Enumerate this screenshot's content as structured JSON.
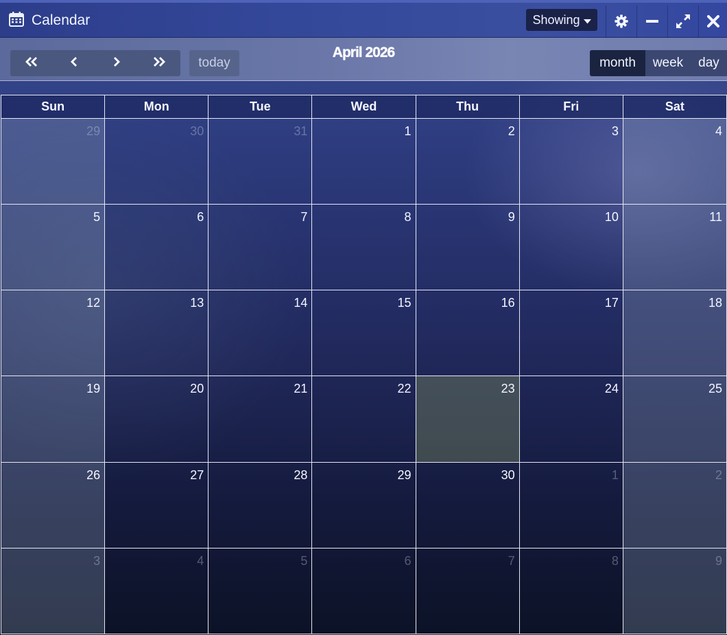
{
  "window": {
    "title": "Calendar",
    "showing_label": "Showing"
  },
  "toolbar": {
    "month_title": "April 2026",
    "today_label": "today",
    "views": [
      "month",
      "week",
      "day"
    ],
    "active_view": "month"
  },
  "calendar": {
    "weekdays": [
      "Sun",
      "Mon",
      "Tue",
      "Wed",
      "Thu",
      "Fri",
      "Sat"
    ],
    "today": 23,
    "weeks": [
      [
        {
          "d": "29",
          "o": true
        },
        {
          "d": "30",
          "o": true
        },
        {
          "d": "31",
          "o": true
        },
        {
          "d": "1"
        },
        {
          "d": "2"
        },
        {
          "d": "3"
        },
        {
          "d": "4"
        }
      ],
      [
        {
          "d": "5"
        },
        {
          "d": "6"
        },
        {
          "d": "7"
        },
        {
          "d": "8"
        },
        {
          "d": "9"
        },
        {
          "d": "10"
        },
        {
          "d": "11"
        }
      ],
      [
        {
          "d": "12"
        },
        {
          "d": "13"
        },
        {
          "d": "14"
        },
        {
          "d": "15"
        },
        {
          "d": "16"
        },
        {
          "d": "17"
        },
        {
          "d": "18"
        }
      ],
      [
        {
          "d": "19"
        },
        {
          "d": "20"
        },
        {
          "d": "21"
        },
        {
          "d": "22"
        },
        {
          "d": "23",
          "t": true
        },
        {
          "d": "24"
        },
        {
          "d": "25"
        }
      ],
      [
        {
          "d": "26"
        },
        {
          "d": "27"
        },
        {
          "d": "28"
        },
        {
          "d": "29"
        },
        {
          "d": "30"
        },
        {
          "d": "1",
          "o": true
        },
        {
          "d": "2",
          "o": true
        }
      ],
      [
        {
          "d": "3",
          "o": true
        },
        {
          "d": "4",
          "o": true
        },
        {
          "d": "5",
          "o": true
        },
        {
          "d": "6",
          "o": true
        },
        {
          "d": "7",
          "o": true
        },
        {
          "d": "8",
          "o": true
        },
        {
          "d": "9",
          "o": true
        }
      ]
    ]
  },
  "icons": {
    "app": "calendar-icon",
    "caret": "caret-down-icon",
    "settings": "gear-icon",
    "minimize": "minimize-icon",
    "maximize": "maximize-icon",
    "close": "close-icon",
    "prev_year": "double-chevron-left-icon",
    "prev": "chevron-left-icon",
    "next": "chevron-right-icon",
    "next_year": "double-chevron-right-icon"
  },
  "colors": {
    "accent": "#3a4fa0",
    "today_cell": "#4d524a",
    "active_view": "#1a2340"
  }
}
